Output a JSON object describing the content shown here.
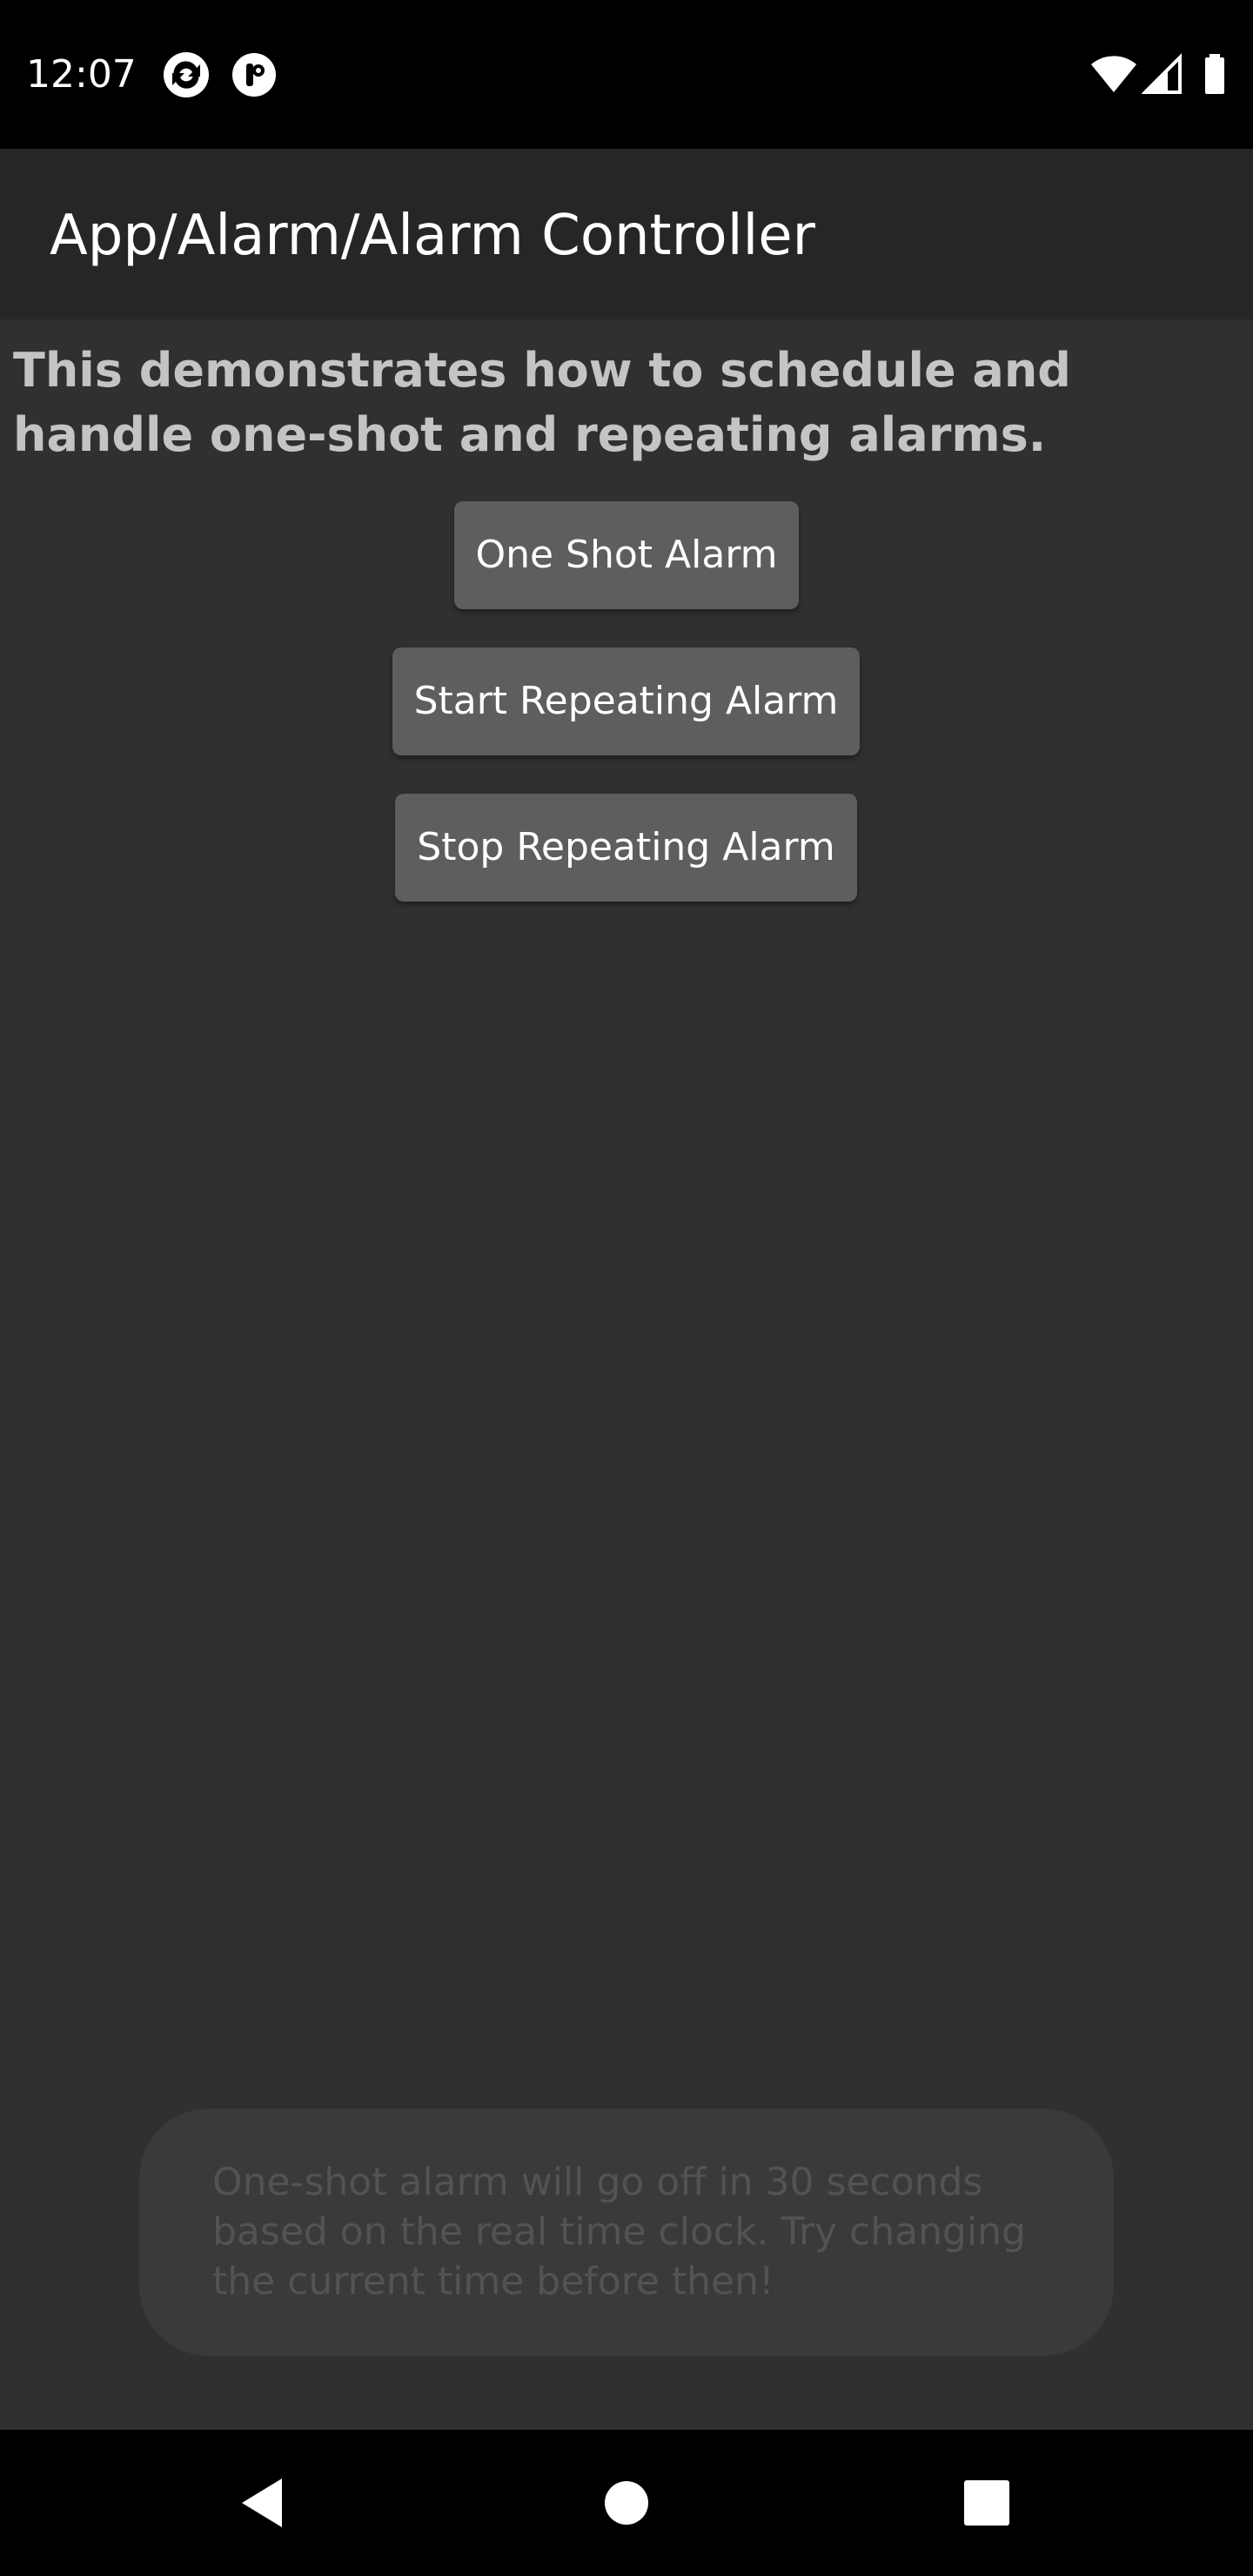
{
  "status_bar": {
    "time": "12:07",
    "left_icons": [
      "sync-app-icon",
      "pocket-casts-icon"
    ],
    "right_icons": [
      "wifi-icon",
      "cell-signal-icon",
      "battery-icon"
    ]
  },
  "app_bar": {
    "title": "App/Alarm/Alarm Controller"
  },
  "main": {
    "description": "This demonstrates how to schedule and handle one-shot and repeating alarms.",
    "buttons": [
      {
        "label": "One Shot Alarm"
      },
      {
        "label": "Start Repeating Alarm"
      },
      {
        "label": "Stop Repeating Alarm"
      }
    ]
  },
  "toast": {
    "message": "One-shot alarm will go off in 30 seconds based on the real time clock. Try changing the current time before then!"
  },
  "nav_bar": {
    "icons": [
      "back-icon",
      "home-icon",
      "recents-icon"
    ]
  },
  "colors": {
    "background": "#303030",
    "app_bar": "#262626",
    "button": "#5e5e5e",
    "status_bar": "#000000"
  }
}
